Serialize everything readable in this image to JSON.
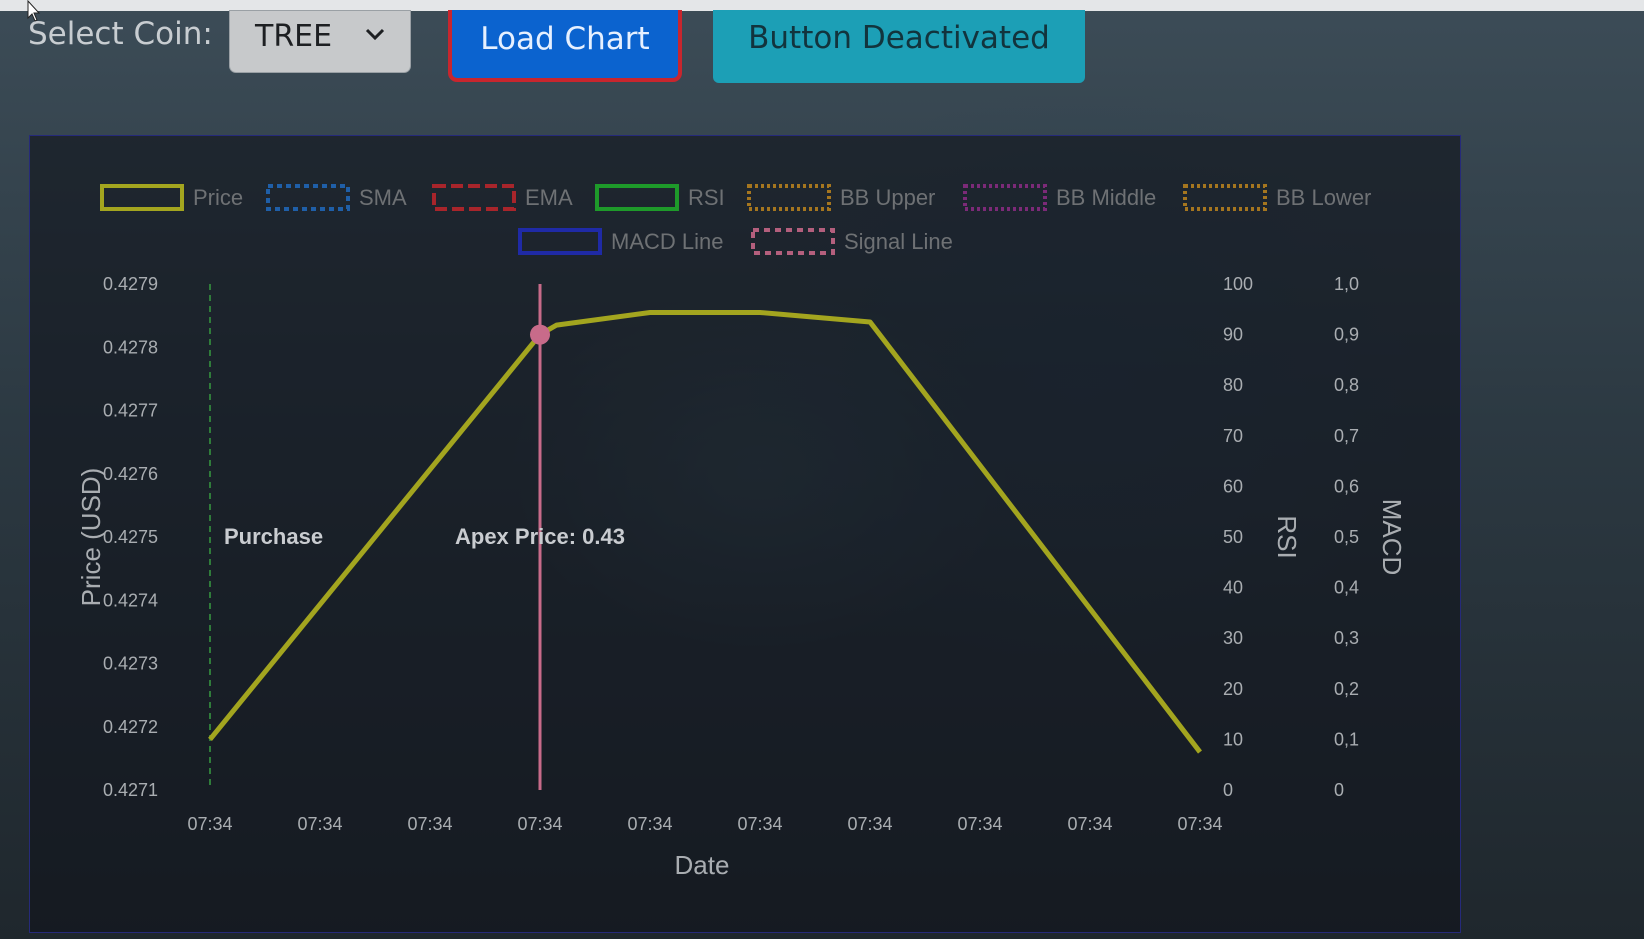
{
  "toolbar": {
    "select_label": "Select Coin:",
    "selected_coin": "TREE",
    "load_button": "Load Chart",
    "deactivated_button": "Button Deactivated"
  },
  "icons": {
    "dropdown": "chevron-down-icon",
    "cursor": "mouse-pointer-icon"
  },
  "colors": {
    "price": "#a3a51f",
    "sma": "#1f5fa8",
    "ema": "#a8252b",
    "rsi": "#1e9a2a",
    "bb_upper": "#a5761f",
    "bb_middle": "#7c2a78",
    "bb_lower": "#a5761f",
    "macd": "#1f2aa6",
    "signal": "#b45f7d",
    "purchase_line": "#2f7c3a",
    "apex_line": "#c86b8a"
  },
  "chart_data": {
    "type": "line",
    "x_label": "Date",
    "y_label": "Price (USD)",
    "y2_label": "RSI",
    "y3_label": "MACD",
    "x_ticks": [
      "07:34",
      "07:34",
      "07:34",
      "07:34",
      "07:34",
      "07:34",
      "07:34",
      "07:34",
      "07:34",
      "07:34"
    ],
    "y_ticks": [
      "0.4271",
      "0.4272",
      "0.4273",
      "0.4274",
      "0.4275",
      "0.4276",
      "0.4277",
      "0.4278",
      "0.4279"
    ],
    "y_range": [
      0.4271,
      0.4279
    ],
    "rsi_ticks": [
      "0",
      "10",
      "20",
      "30",
      "40",
      "50",
      "60",
      "70",
      "80",
      "90",
      "100"
    ],
    "rsi_range": [
      0,
      100
    ],
    "macd_ticks": [
      "0",
      "0,1",
      "0,2",
      "0,3",
      "0,4",
      "0,5",
      "0,6",
      "0,7",
      "0,8",
      "0,9",
      "1,0"
    ],
    "macd_range": [
      0,
      1
    ],
    "legend": [
      "Price",
      "SMA",
      "EMA",
      "RSI",
      "BB Upper",
      "BB Middle",
      "BB Lower",
      "MACD Line",
      "Signal Line"
    ],
    "legend_position": "top-center",
    "series": [
      {
        "name": "Price",
        "x": [
          0,
          3,
          3.15,
          4,
          5,
          6,
          9
        ],
        "values": [
          0.42718,
          0.42782,
          0.427835,
          0.427855,
          0.427855,
          0.42784,
          0.42716
        ]
      }
    ],
    "annotations": [
      {
        "label": "Purchase",
        "x": 0
      },
      {
        "label": "Apex Price: 0.43",
        "x": 3,
        "y": 0.42782
      }
    ]
  }
}
